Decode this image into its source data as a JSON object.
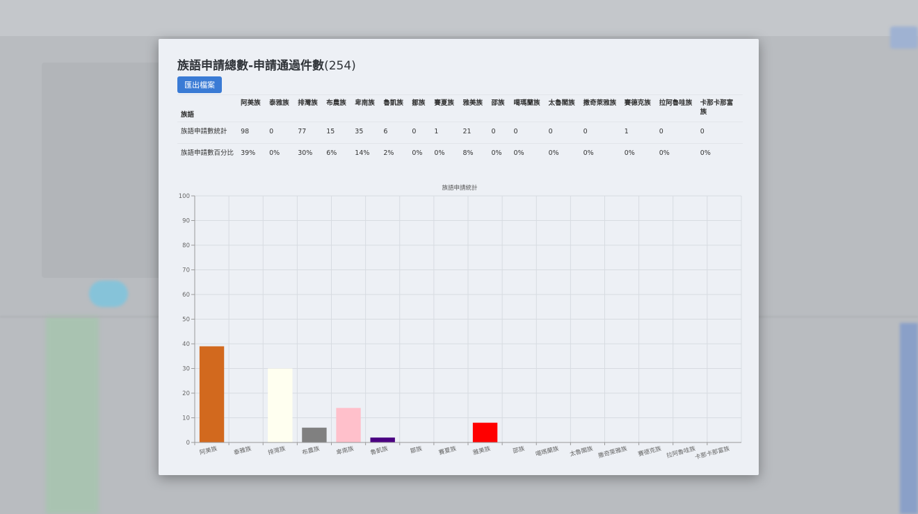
{
  "modal": {
    "title": "族語申請總數-申請通過件數",
    "title_count": "(254)",
    "export_label": "匯出檔案"
  },
  "table": {
    "corner_header": "族語",
    "columns": [
      "阿美族",
      "泰雅族",
      "排灣族",
      "布農族",
      "卑南族",
      "魯凱族",
      "鄒族",
      "賽夏族",
      "雅美族",
      "邵族",
      "噶瑪蘭族",
      "太魯閣族",
      "撒奇萊雅族",
      "賽德克族",
      "拉阿魯哇族",
      "卡那卡那富族"
    ],
    "rows": [
      {
        "label": "族語申請數統計",
        "cells": [
          "98",
          "0",
          "77",
          "15",
          "35",
          "6",
          "0",
          "1",
          "21",
          "0",
          "0",
          "0",
          "0",
          "1",
          "0",
          "0"
        ]
      },
      {
        "label": "族語申請數百分比",
        "cells": [
          "39%",
          "0%",
          "30%",
          "6%",
          "14%",
          "2%",
          "0%",
          "0%",
          "8%",
          "0%",
          "0%",
          "0%",
          "0%",
          "0%",
          "0%",
          "0%"
        ]
      }
    ]
  },
  "chart_data": {
    "type": "bar",
    "title": "族語申請統計",
    "categories": [
      "阿美族",
      "泰雅族",
      "排灣族",
      "布農族",
      "卑南族",
      "魯凱族",
      "鄒族",
      "賽夏族",
      "雅美族",
      "邵族",
      "噶瑪蘭族",
      "太魯閣族",
      "撒奇萊雅族",
      "賽德克族",
      "拉阿魯哇族",
      "卡那卡那富族"
    ],
    "values": [
      39,
      0,
      30,
      6,
      14,
      2,
      0,
      0,
      8,
      0,
      0,
      0,
      0,
      0,
      0,
      0
    ],
    "bar_colors": [
      "#d2691e",
      "#ffffff",
      "#fffff0",
      "#808080",
      "#ffc0cb",
      "#4b0082",
      "#ffffff",
      "#ffffff",
      "#ff0000",
      "#ffffff",
      "#ffffff",
      "#ffffff",
      "#ffffff",
      "#ffffff",
      "#ffffff",
      "#ffffff"
    ],
    "ylim": [
      0,
      100
    ],
    "yticks": [
      0,
      10,
      20,
      30,
      40,
      50,
      60,
      70,
      80,
      90,
      100
    ],
    "grid": true,
    "legend": "none"
  }
}
